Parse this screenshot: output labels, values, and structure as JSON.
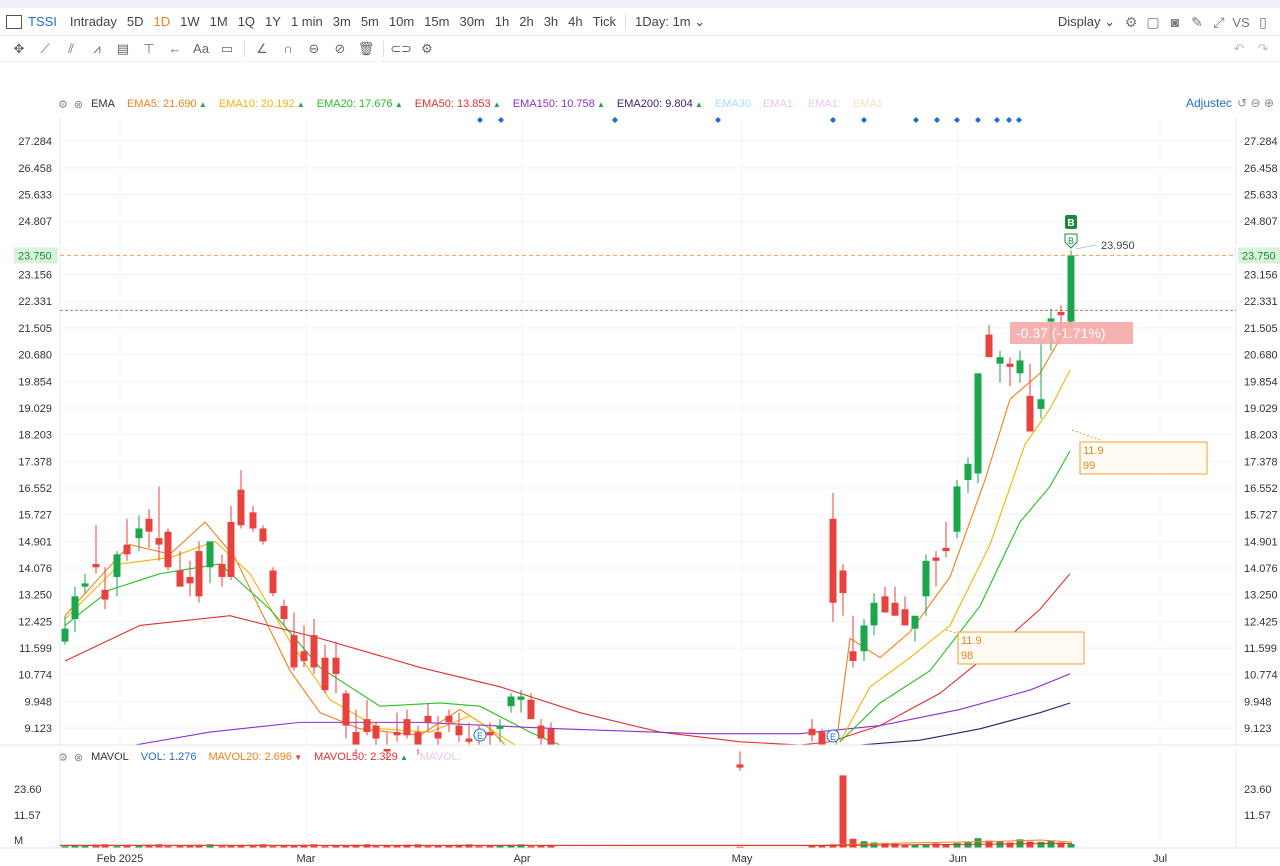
{
  "header": {
    "symbol": "TSSI",
    "timeframes": [
      "Intraday",
      "5D",
      "1D",
      "1W",
      "1M",
      "1Q",
      "1Y",
      "1 min",
      "3m",
      "5m",
      "10m",
      "15m",
      "30m",
      "1h",
      "2h",
      "3h",
      "4h",
      "Tick"
    ],
    "active_timeframe": "1D",
    "interval_select": "1Day: 1m",
    "display_label": "Display",
    "vs_label": "VS"
  },
  "ema_legend": {
    "title": "EMA",
    "items": [
      {
        "label": "EMA5:",
        "value": "21.690",
        "color": "#f2801a"
      },
      {
        "label": "EMA10:",
        "value": "20.192",
        "color": "#f5b400"
      },
      {
        "label": "EMA20:",
        "value": "17.676",
        "color": "#22c322"
      },
      {
        "label": "EMA50:",
        "value": "13.853",
        "color": "#e03030"
      },
      {
        "label": "EMA150:",
        "value": "10.758",
        "color": "#8e2ecf"
      },
      {
        "label": "EMA200:",
        "value": "9.804",
        "color": "#3b1a6a"
      }
    ],
    "hidden_items": [
      "EMA30",
      "EMA1:",
      "EMA1:",
      "EMA1"
    ],
    "adjusted_label": "Adjustec"
  },
  "vol_legend": {
    "title": "MAVOL",
    "items": [
      {
        "label": "VOL:",
        "value": "1.276",
        "color": "#1a6fd6"
      },
      {
        "label": "MAVOL20:",
        "value": "2.696",
        "color": "#f2801a"
      },
      {
        "label": "MAVOL50:",
        "value": "2.329",
        "color": "#e03030"
      }
    ],
    "hidden_item": "MAVOL:"
  },
  "price_axis": [
    "27.284",
    "26.458",
    "25.633",
    "24.807",
    "23.156",
    "22.331",
    "21.505",
    "20.680",
    "19.854",
    "19.029",
    "18.203",
    "17.378",
    "16.552",
    "15.727",
    "14.901",
    "14.076",
    "13.250",
    "12.425",
    "11.599",
    "10.774",
    "9.948",
    "9.123"
  ],
  "current_price": "23.750",
  "high_label": "23.950",
  "change_label": "-0.37 (-1.71%)",
  "annotation_boxes": [
    {
      "line1": "11.9",
      "line2": "99"
    },
    {
      "line1": "11.9",
      "line2": "98"
    }
  ],
  "volume_axis": [
    "23.60",
    "11.57",
    "M"
  ],
  "date_axis": [
    "Feb 2025",
    "Mar",
    "Apr",
    "May",
    "Jun",
    "Jul"
  ],
  "signal_labels": {
    "buy": "B",
    "earnings": "E"
  },
  "colors": {
    "up": "#1aa64a",
    "down": "#e8423f",
    "accent": "#f2801a",
    "link": "#1a6fd6"
  },
  "chart_data": {
    "type": "candlestick",
    "ylim": [
      8.6,
      28.0
    ],
    "candles": [
      [
        11.8,
        12.6,
        11.7,
        12.2
      ],
      [
        12.5,
        13.5,
        12.1,
        13.2
      ],
      [
        13.5,
        13.9,
        13.3,
        13.6
      ],
      [
        14.2,
        15.4,
        13.9,
        14.1
      ],
      [
        13.4,
        14.1,
        12.8,
        13.1
      ],
      [
        13.8,
        14.6,
        13.2,
        14.5
      ],
      [
        14.8,
        15.6,
        14.3,
        14.5
      ],
      [
        15.0,
        15.7,
        14.6,
        15.3
      ],
      [
        15.6,
        15.9,
        14.7,
        15.2
      ],
      [
        15.0,
        16.6,
        14.3,
        14.8
      ],
      [
        15.2,
        15.3,
        14.0,
        14.1
      ],
      [
        14.0,
        14.6,
        13.7,
        13.5
      ],
      [
        13.8,
        14.3,
        13.2,
        13.6
      ],
      [
        14.6,
        14.9,
        13.0,
        13.2
      ],
      [
        14.1,
        14.9,
        13.6,
        14.9
      ],
      [
        14.2,
        14.5,
        13.5,
        13.8
      ],
      [
        15.5,
        16.0,
        13.7,
        13.8
      ],
      [
        16.5,
        17.1,
        15.3,
        15.4
      ],
      [
        15.8,
        16.0,
        15.2,
        15.3
      ],
      [
        15.3,
        15.4,
        14.8,
        14.9
      ],
      [
        14.0,
        14.1,
        13.2,
        13.3
      ],
      [
        12.9,
        13.1,
        12.3,
        12.5
      ],
      [
        12.0,
        12.7,
        10.9,
        11.0
      ],
      [
        11.5,
        12.3,
        11.0,
        11.2
      ],
      [
        12.0,
        12.5,
        10.8,
        11.0
      ],
      [
        11.3,
        11.7,
        10.2,
        10.3
      ],
      [
        11.3,
        11.8,
        10.2,
        10.8
      ],
      [
        10.2,
        10.3,
        8.8,
        9.2
      ],
      [
        9.0,
        9.7,
        8.3,
        8.6
      ],
      [
        9.4,
        10.0,
        8.9,
        9.0
      ],
      [
        9.2,
        9.3,
        8.6,
        8.8
      ],
      [
        8.6,
        9.0,
        8.2,
        8.4
      ],
      [
        9.0,
        9.6,
        8.7,
        8.9
      ],
      [
        9.4,
        9.7,
        8.8,
        8.9
      ],
      [
        9.0,
        9.2,
        8.3,
        8.5
      ],
      [
        9.5,
        9.9,
        9.0,
        9.3
      ],
      [
        9.0,
        9.5,
        8.6,
        8.8
      ],
      [
        9.5,
        9.7,
        9.0,
        9.3
      ],
      [
        9.2,
        9.6,
        8.7,
        8.9
      ],
      [
        8.8,
        9.3,
        8.5,
        8.7
      ],
      [
        9.0,
        9.2,
        8.6,
        8.9
      ],
      [
        9.0,
        9.3,
        8.6,
        8.9
      ],
      [
        9.1,
        9.4,
        8.7,
        9.2
      ],
      [
        9.8,
        10.2,
        9.6,
        10.1
      ],
      [
        10.0,
        10.3,
        9.6,
        10.1
      ],
      [
        10.0,
        10.2,
        9.7,
        9.4
      ],
      [
        9.2,
        9.4,
        8.6,
        8.8
      ],
      [
        9.1,
        9.3,
        8.5,
        8.6
      ]
    ],
    "candles_part2": [
      [
        8.0,
        8.4,
        7.8,
        7.9
      ],
      [
        9.1,
        9.4,
        8.7,
        8.9
      ],
      [
        9.0,
        9.1,
        8.6,
        8.5
      ],
      [
        15.6,
        16.4,
        12.4,
        13.0
      ],
      [
        14.0,
        14.2,
        12.6,
        13.3
      ],
      [
        11.5,
        12.6,
        11.0,
        11.2
      ],
      [
        11.5,
        12.5,
        11.2,
        12.3
      ],
      [
        12.3,
        13.3,
        12.0,
        13.0
      ],
      [
        13.2,
        13.5,
        12.8,
        12.7
      ],
      [
        13.0,
        13.5,
        12.6,
        12.6
      ],
      [
        12.8,
        13.2,
        12.3,
        12.3
      ],
      [
        12.2,
        12.4,
        11.8,
        12.6
      ],
      [
        13.2,
        14.5,
        12.6,
        14.3
      ],
      [
        14.4,
        14.6,
        13.5,
        14.3
      ],
      [
        14.7,
        15.5,
        14.4,
        14.6
      ],
      [
        15.2,
        16.8,
        15.0,
        16.6
      ],
      [
        16.8,
        17.5,
        16.4,
        17.3
      ],
      [
        17.0,
        19.8,
        16.7,
        20.1
      ],
      [
        21.3,
        21.6,
        20.6,
        20.6
      ],
      [
        20.4,
        20.8,
        19.8,
        20.6
      ],
      [
        20.4,
        20.6,
        19.7,
        20.3
      ],
      [
        20.1,
        20.8,
        19.8,
        20.5
      ],
      [
        19.4,
        20.4,
        18.3,
        18.3
      ],
      [
        19.0,
        21.0,
        18.7,
        19.3
      ],
      [
        21.7,
        22.1,
        20.8,
        21.8
      ],
      [
        22.0,
        22.2,
        21.4,
        21.9
      ],
      [
        21.7,
        23.9,
        21.5,
        23.75
      ]
    ],
    "candle_x": [
      [
        65,
        75,
        85,
        96,
        105,
        117,
        127,
        139,
        149,
        159,
        168,
        180,
        190,
        199,
        210,
        222,
        231,
        241,
        253,
        263,
        273,
        284,
        294,
        304,
        314,
        325,
        336,
        346,
        356,
        367,
        376,
        387,
        397,
        407,
        418,
        428,
        438,
        449,
        459,
        469,
        479,
        490,
        500,
        511,
        521,
        531,
        541,
        551
      ]
    ],
    "volume_ylim": [
      0,
      26
    ]
  }
}
